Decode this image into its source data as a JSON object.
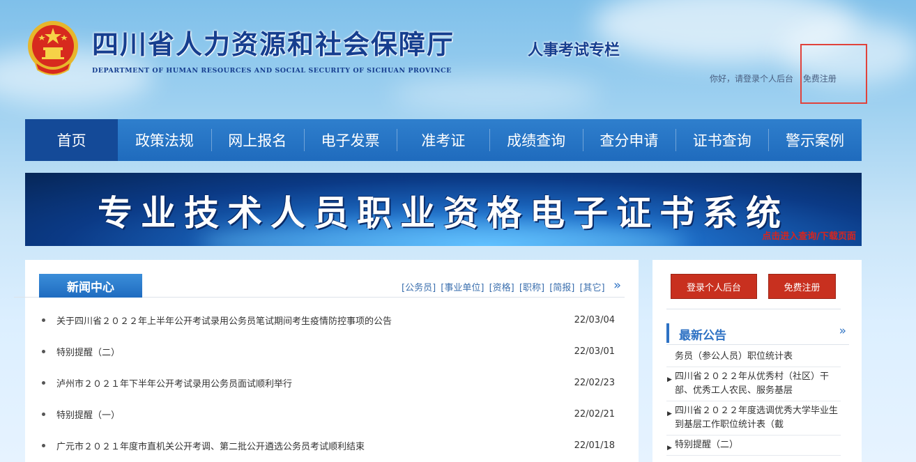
{
  "header": {
    "title": "四川省人力资源和社会保障厅",
    "subtitle": "DEPARTMENT OF HUMAN RESOURCES AND SOCIAL SECURITY OF SICHUAN PROVINCE",
    "column": "人事考试专栏",
    "greeting": "你好，请登录个人后台",
    "register": "免费注册"
  },
  "nav": [
    {
      "label": "首页",
      "active": true
    },
    {
      "label": "政策法规"
    },
    {
      "label": "网上报名"
    },
    {
      "label": "电子发票"
    },
    {
      "label": "准考证"
    },
    {
      "label": "成绩查询"
    },
    {
      "label": "查分申请"
    },
    {
      "label": "证书查询"
    },
    {
      "label": "警示案例"
    }
  ],
  "banner": {
    "title": "专业技术人员职业资格电子证书系统",
    "link": "点击进入查询/下载页面"
  },
  "news": {
    "tab": "新闻中心",
    "categories": [
      "[公务员]",
      "[事业单位]",
      "[资格]",
      "[职称]",
      "[简报]",
      "[其它]"
    ],
    "more": "»",
    "items": [
      {
        "title": "关于四川省２０２２年上半年公开考试录用公务员笔试期间考生疫情防控事项的公告",
        "date": "22/03/04"
      },
      {
        "title": "特别提醒（二）",
        "date": "22/03/01"
      },
      {
        "title": "泸州市２０２１年下半年公开考试录用公务员面试顺利举行",
        "date": "22/02/23"
      },
      {
        "title": "特别提醒（一）",
        "date": "22/02/21"
      },
      {
        "title": "广元市２０２１年度市直机关公开考调、第二批公开遴选公务员考试顺利结束",
        "date": "22/01/18"
      }
    ]
  },
  "side": {
    "login_button": "登录个人后台",
    "register_button": "免费注册",
    "notice_title": "最新公告",
    "notice_more": "»",
    "notices": [
      {
        "text": "务员（参公人员）职位统计表",
        "arrow": false
      },
      {
        "text": "四川省２０２２年从优秀村（社区）干部、优秀工人农民、服务基层",
        "arrow": true
      },
      {
        "text": "四川省２０２２年度选调优秀大学毕业生到基层工作职位统计表（截",
        "arrow": true
      },
      {
        "text": "特别提醒（二）",
        "arrow": true
      }
    ]
  },
  "colors": {
    "nav_bg": "#1f6bbd",
    "nav_active": "#144a98",
    "accent_red": "#c8301f",
    "title_blue": "#163e8f"
  }
}
